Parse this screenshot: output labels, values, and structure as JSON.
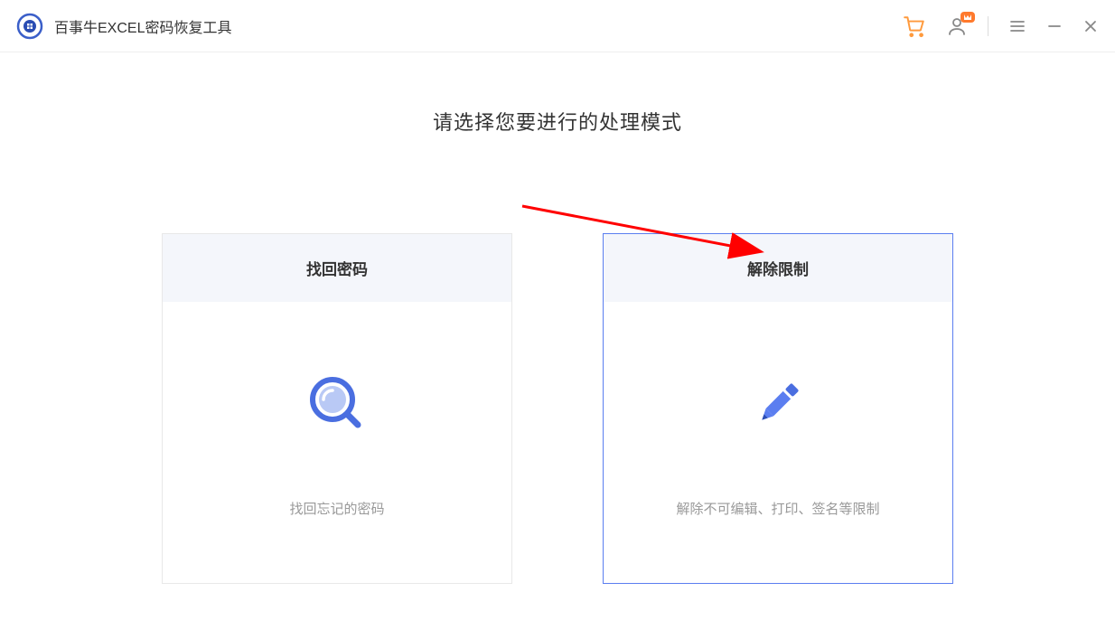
{
  "app": {
    "title": "百事牛EXCEL密码恢复工具"
  },
  "main": {
    "heading": "请选择您要进行的处理模式"
  },
  "cards": {
    "recover": {
      "title": "找回密码",
      "desc": "找回忘记的密码"
    },
    "unlock": {
      "title": "解除限制",
      "desc": "解除不可编辑、打印、签名等限制"
    }
  },
  "icons": {
    "cart": "cart",
    "user": "user",
    "menu": "menu",
    "minimize": "minimize",
    "close": "close"
  }
}
